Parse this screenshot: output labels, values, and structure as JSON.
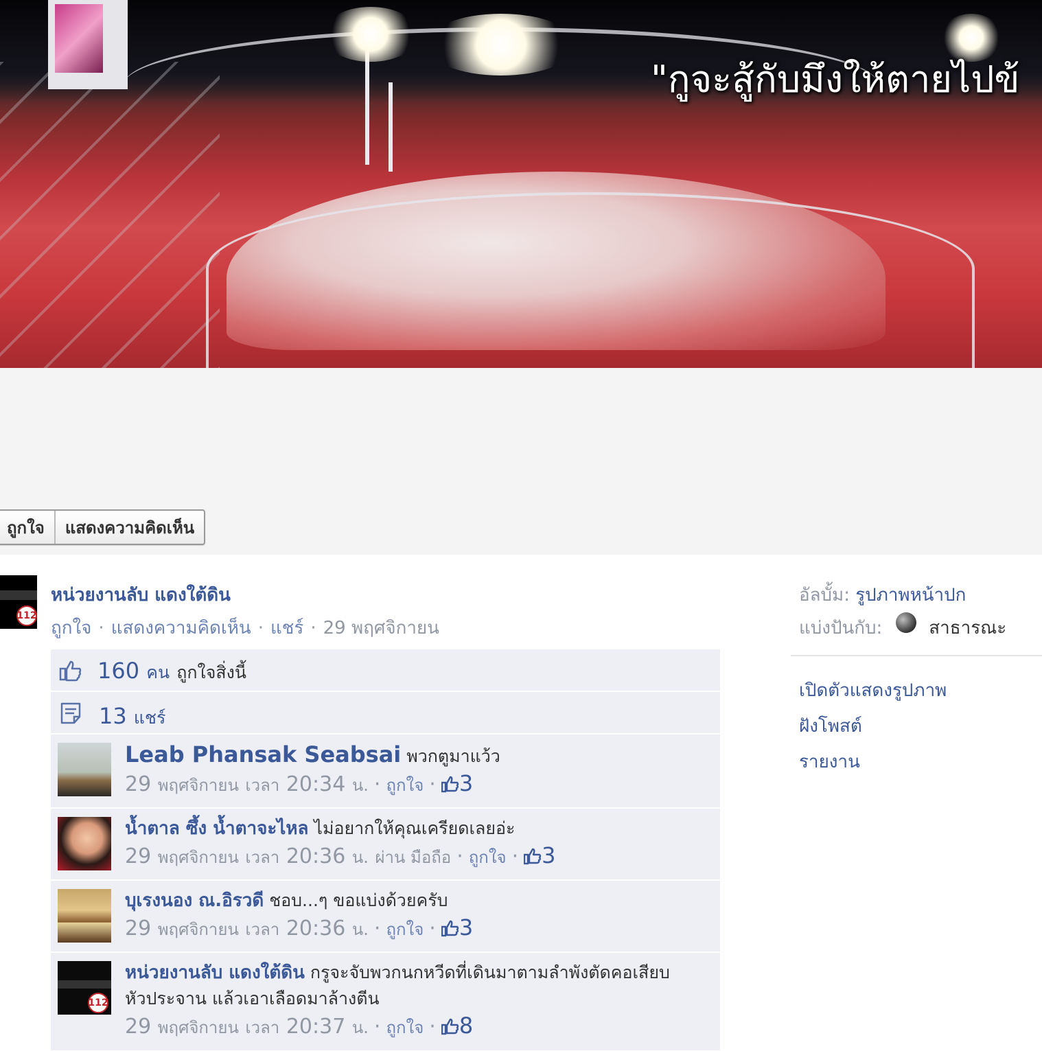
{
  "cover": {
    "slogan": "\"กูจะสู้กับมึงให้ตายไปข้"
  },
  "actions": {
    "like_label": "ถูกใจ",
    "comment_label": "แสดงความคิดเห็น"
  },
  "post": {
    "author": "หน่วยงานลับ แดงใต้ดิน",
    "avatar_badge": "112",
    "meta": {
      "like": "ถูกใจ",
      "comment": "แสดงความคิดเห็น",
      "share": "แชร์",
      "date": "29 พฤศจิกายน"
    },
    "likes": {
      "count": "160",
      "unit": "คน",
      "text": "ถูกใจสิ่งนี้"
    },
    "shares": {
      "count": "13",
      "text": "แชร์"
    }
  },
  "comments": [
    {
      "name": "Leab Phansak Seabsai",
      "text": "พวกตูมาแว้ว",
      "day": "29",
      "month": "พฤศจิกายน",
      "time_prefix": "เวลา",
      "time": "20:34",
      "time_suffix": "น.",
      "via": "",
      "like": "ถูกใจ",
      "likes": "3"
    },
    {
      "name": "น้ำตาล ซึ้ง น้ำตาจะไหล",
      "text": "ไม่อยากให้คุณเครียดเลยอ่ะ",
      "day": "29",
      "month": "พฤศจิกายน",
      "time_prefix": "เวลา",
      "time": "20:36",
      "time_suffix": "น.",
      "via": "ผ่าน มือถือ",
      "like": "ถูกใจ",
      "likes": "3"
    },
    {
      "name": "บุเรงนอง ณ.อิรวดี",
      "text": "ชอบ...ๆ ขอแบ่งด้วยครับ",
      "day": "29",
      "month": "พฤศจิกายน",
      "time_prefix": "เวลา",
      "time": "20:36",
      "time_suffix": "น.",
      "via": "",
      "like": "ถูกใจ",
      "likes": "3"
    },
    {
      "name": "หน่วยงานลับ แดงใต้ดิน",
      "text": "กรูจะจับพวกนกหวีดที่เดินมาตามลำพังตัดคอเสียบหัวประจาน แล้วเอาเลือดมาล้างตีน",
      "day": "29",
      "month": "พฤศจิกายน",
      "time_prefix": "เวลา",
      "time": "20:37",
      "time_suffix": "น.",
      "via": "",
      "like": "ถูกใจ",
      "likes": "8",
      "avatar_badge": "112"
    }
  ],
  "sidebar": {
    "album_label": "อัลบั้ม:",
    "album_value": "รูปภาพหน้าปก",
    "shared_label": "แบ่งปันกับ:",
    "shared_value": "สาธารณะ",
    "links": [
      "เปิดตัวแสดงรูปภาพ",
      "ฝังโพสต์",
      "รายงาน"
    ]
  },
  "colors": {
    "link": "#3b5998",
    "meta": "#9197a3",
    "ufi_bg": "#edeff4",
    "band_bg": "#f4f4f4"
  },
  "icons": {
    "like": "thumbs-up-icon",
    "share": "share-icon",
    "privacy": "globe-icon"
  }
}
